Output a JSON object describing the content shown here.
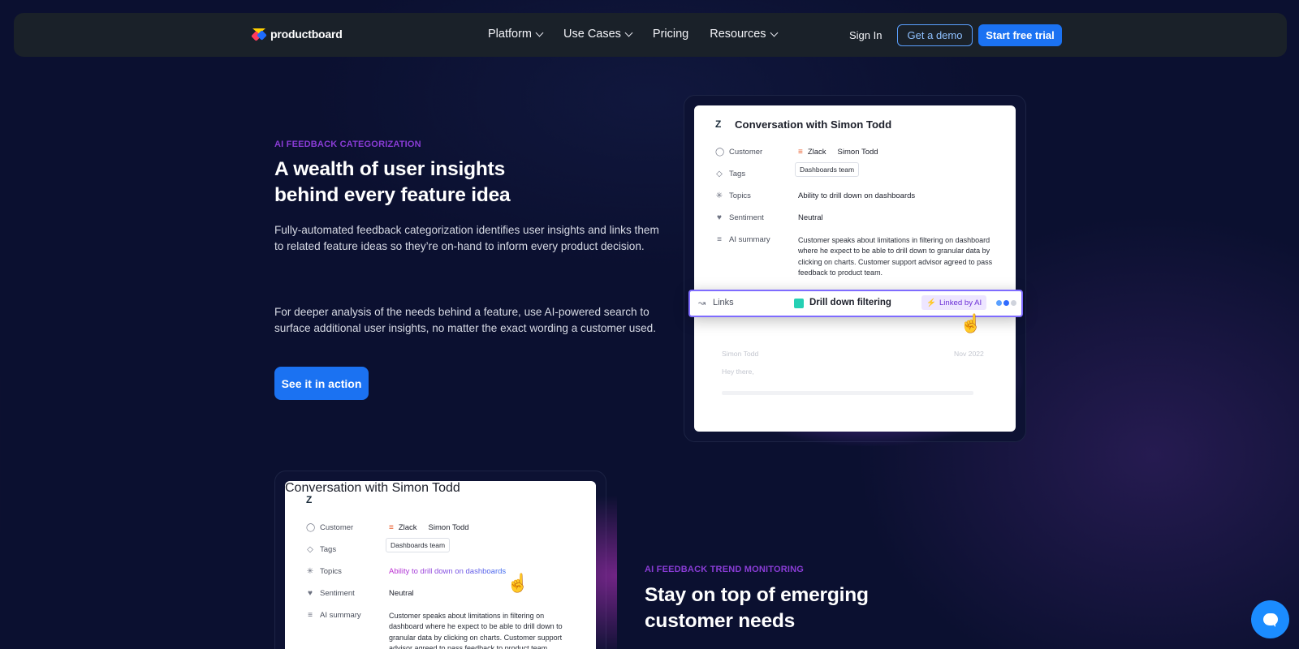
{
  "nav": {
    "logo_text": "productboard",
    "menu": [
      {
        "label": "Platform",
        "has_dropdown": true
      },
      {
        "label": "Use Cases",
        "has_dropdown": true
      },
      {
        "label": "Pricing",
        "has_dropdown": false
      },
      {
        "label": "Resources",
        "has_dropdown": true
      }
    ],
    "sign_in": "Sign In",
    "demo": "Get a demo",
    "trial": "Start free trial"
  },
  "section1": {
    "eyebrow": "AI FEEDBACK CATEGORIZATION",
    "headline": "A wealth of user insights behind every feature idea",
    "para1": "Fully-automated feedback categorization identifies user insights and links them to related feature ideas so they’re on-hand to inform every product decision.",
    "para2": "For deeper analysis of the needs behind a feature, use AI-powered search to surface additional user insights, no matter the exact wording a customer used.",
    "cta": "See it in action"
  },
  "card": {
    "title": "Conversation with Simon Todd",
    "zendesk_icon": "Z",
    "customer_label": "Customer",
    "company": "Zlack",
    "person": "Simon Todd",
    "tags_label": "Tags",
    "tag": "Dashboards team",
    "topics_label": "Topics",
    "topic": "Ability to drill down on dashboards",
    "sentiment_label": "Sentiment",
    "sentiment": "Neutral",
    "summary_label": "AI summary",
    "summary": "Customer speaks about limitations in filtering on dashboard where he expect to be able to drill down to granular data by clicking on charts. Customer support advisor agreed to pass feedback to product team.",
    "links_label": "Links",
    "linked_feature": "Drill down filtering",
    "ai_badge": "Linked by AI",
    "msg_author": "Simon Todd",
    "msg_date": "Nov 2022",
    "msg_text": "Hey there,"
  },
  "section2": {
    "eyebrow": "AI FEEDBACK TREND MONITORING",
    "headline": "Stay on top of emerging customer needs"
  },
  "colors": {
    "background": "#0b1030",
    "accent": "#1b72f2",
    "eyebrow": "#8a3cd6",
    "link_dot": "#25d0b4"
  },
  "icons": {
    "menu_chevron": "chevron-down-icon",
    "chat": "chat-bubble-icon",
    "cursor": "hand-pointer-icon"
  }
}
